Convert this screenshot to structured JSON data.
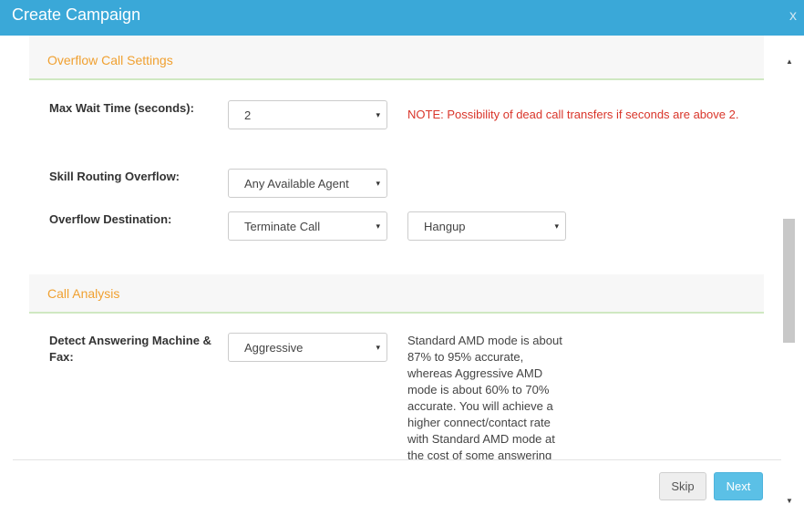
{
  "dialog": {
    "title": "Create Campaign",
    "close_label": "x"
  },
  "overflow": {
    "section_title": "Overflow Call Settings",
    "max_wait_label": "Max Wait Time (seconds):",
    "max_wait_value": "2",
    "note": "NOTE: Possibility of dead call transfers if seconds are above 2.",
    "skill_routing_label": "Skill Routing Overflow:",
    "skill_routing_value": "Any Available Agent",
    "destination_label": "Overflow Destination:",
    "destination_value": "Terminate Call",
    "destination_action_value": "Hangup"
  },
  "call_analysis": {
    "section_title": "Call Analysis",
    "detect_label": "Detect Answering Machine & Fax:",
    "detect_value": "Aggressive",
    "amd_description": "Standard AMD mode is about 87% to 95% accurate, whereas Aggressive AMD mode is about 60% to 70% accurate. You will achieve a higher connect/contact rate with Standard AMD mode at the cost of some answering"
  },
  "footer": {
    "skip_label": "Skip",
    "next_label": "Next"
  },
  "icons": {
    "caret": "▾",
    "scroll_up": "▲",
    "scroll_down": "▼"
  },
  "colors": {
    "titlebar": "#3aa8d8",
    "section_title": "#f0a030",
    "note": "#d9352a",
    "next_button": "#5bc0e6"
  }
}
